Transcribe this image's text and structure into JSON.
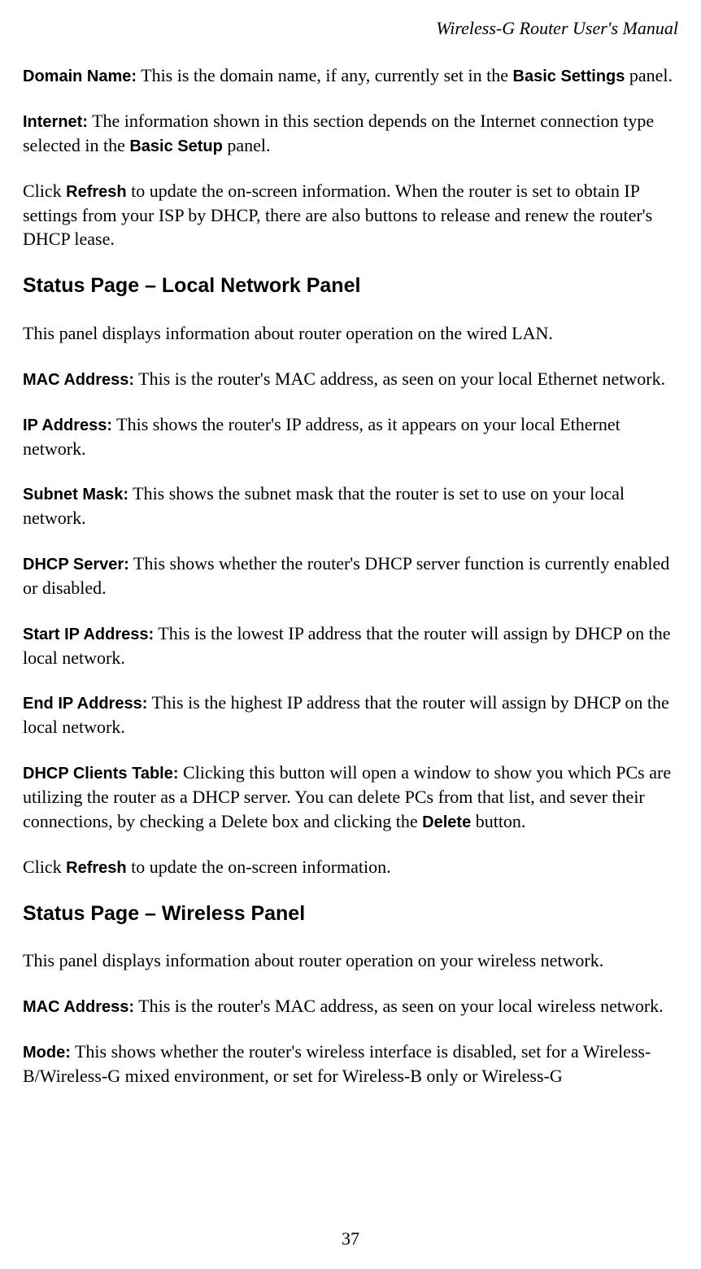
{
  "header": {
    "title": "Wireless-G Router User's Manual"
  },
  "content": {
    "domainName": {
      "label": "Domain Name:",
      "text1": " This is the domain name, if any, currently set in the ",
      "bold1": "Basic Settings",
      "text2": " panel."
    },
    "internet": {
      "label": "Internet:",
      "text1": " The information shown in this section depends on the Internet connection type selected in the ",
      "bold1": "Basic Setup",
      "text2": " panel."
    },
    "refresh1": {
      "text1": "Click ",
      "bold1": "Refresh",
      "text2": " to update the on-screen information. When the router is set to obtain IP settings from your ISP by DHCP, there are also buttons to release and renew the router's DHCP lease."
    },
    "h2_localNetwork": "Status Page – Local Network Panel",
    "localNetworkIntro": "This panel displays information about router operation on the wired LAN.",
    "macAddress": {
      "label": "MAC Address:",
      "text": " This is the router's MAC address, as seen on your local Ethernet network."
    },
    "ipAddress": {
      "label": "IP Address:",
      "text": " This shows the router's IP address, as it appears on your local Ethernet network."
    },
    "subnetMask": {
      "label": "Subnet Mask:",
      "text": " This shows the subnet mask that the router is set to use on your local network."
    },
    "dhcpServer": {
      "label": "DHCP Server:",
      "text": " This shows whether the router's DHCP server function is currently enabled or disabled."
    },
    "startIp": {
      "label": "Start IP Address:",
      "text": " This is the lowest IP address that the router will assign by DHCP on the local network."
    },
    "endIp": {
      "label": "End IP Address:",
      "text": " This is the highest IP address that the router will assign by DHCP on the local network."
    },
    "dhcpClients": {
      "label": "DHCP Clients Table:",
      "text1": " Clicking this button will open a window to show you which PCs are utilizing the router as a DHCP server. You can delete PCs from that list, and sever their connections, by checking a Delete box and clicking the ",
      "bold1": "Delete",
      "text2": " button."
    },
    "refresh2": {
      "text1": "Click ",
      "bold1": "Refresh",
      "text2": " to update the on-screen information."
    },
    "h2_wireless": "Status Page – Wireless Panel",
    "wirelessIntro": "This panel displays information about router operation on your wireless network.",
    "macAddressWireless": {
      "label": "MAC Address:",
      "text": " This is the router's MAC address, as seen on your local wireless network."
    },
    "mode": {
      "label": "Mode:",
      "text": " This shows whether the router's wireless interface is disabled, set for a Wireless-B/Wireless-G mixed environment, or set for Wireless-B only or Wireless-G"
    }
  },
  "pageNumber": "37"
}
